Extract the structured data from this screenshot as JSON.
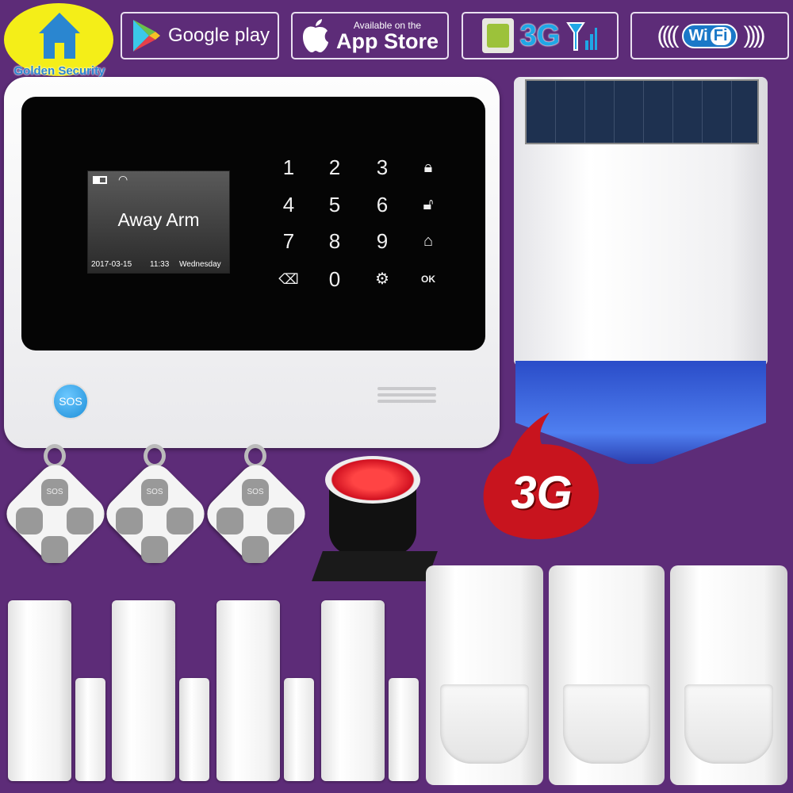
{
  "brand": {
    "name": "Golden Security",
    "icon": "house-icon",
    "color": "#2a86d0"
  },
  "badges": {
    "google_play": {
      "label": "Google play",
      "icon": "google-play-icon"
    },
    "app_store": {
      "small": "Available on the",
      "label": "App Store",
      "icon": "apple-icon"
    },
    "network": {
      "label": "3G",
      "icons": [
        "sim-card-icon",
        "antenna-signal-icon"
      ]
    },
    "wifi": {
      "wi": "Wi",
      "fi": "Fi"
    }
  },
  "panel": {
    "lcd": {
      "status_text": "Away Arm",
      "date": "2017-03-15",
      "time": "11:33",
      "day": "Wednesday",
      "icons": [
        "battery-icon",
        "wifi-icon"
      ]
    },
    "keypad": [
      [
        "1",
        "2",
        "3",
        "lock-icon"
      ],
      [
        "4",
        "5",
        "6",
        "unlock-icon"
      ],
      [
        "7",
        "8",
        "9",
        "home-arm-icon"
      ],
      [
        "backspace-icon",
        "0",
        "settings-icon",
        "ok-icon"
      ]
    ],
    "sos_label": "SOS"
  },
  "promo": {
    "label": "3G"
  },
  "fobs": {
    "sos_label": "SOS",
    "count": 3
  },
  "colors": {
    "background": "#5d2c78",
    "accent_blue": "#1e8fd8",
    "red": "#c8141e"
  }
}
